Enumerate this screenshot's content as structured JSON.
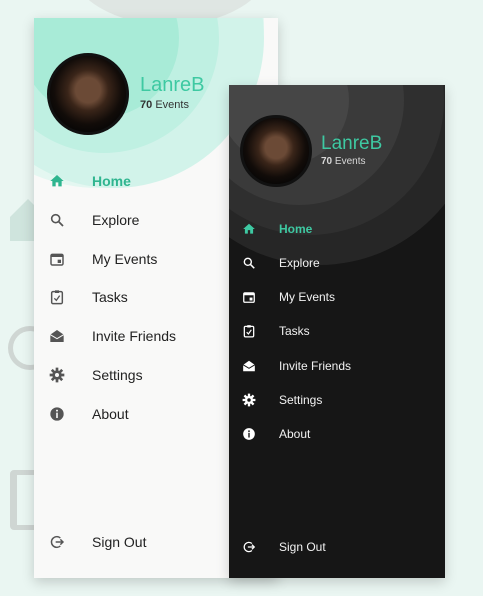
{
  "colors": {
    "accent": "#3ec9a2",
    "light_bg": "#f9f9f8",
    "dark_bg": "#161616"
  },
  "profile": {
    "name": "LanreB",
    "events_count": "70",
    "events_label": "Events"
  },
  "menu": [
    {
      "label": "Home",
      "icon": "home-icon",
      "active": true
    },
    {
      "label": "Explore",
      "icon": "search-icon"
    },
    {
      "label": "My Events",
      "icon": "calendar-icon"
    },
    {
      "label": "Tasks",
      "icon": "tasks-icon"
    },
    {
      "label": "Invite Friends",
      "icon": "invite-icon"
    },
    {
      "label": "Settings",
      "icon": "gear-icon"
    },
    {
      "label": "About",
      "icon": "info-icon"
    }
  ],
  "sign_out": {
    "label": "Sign Out",
    "icon": "sign-out-icon"
  }
}
